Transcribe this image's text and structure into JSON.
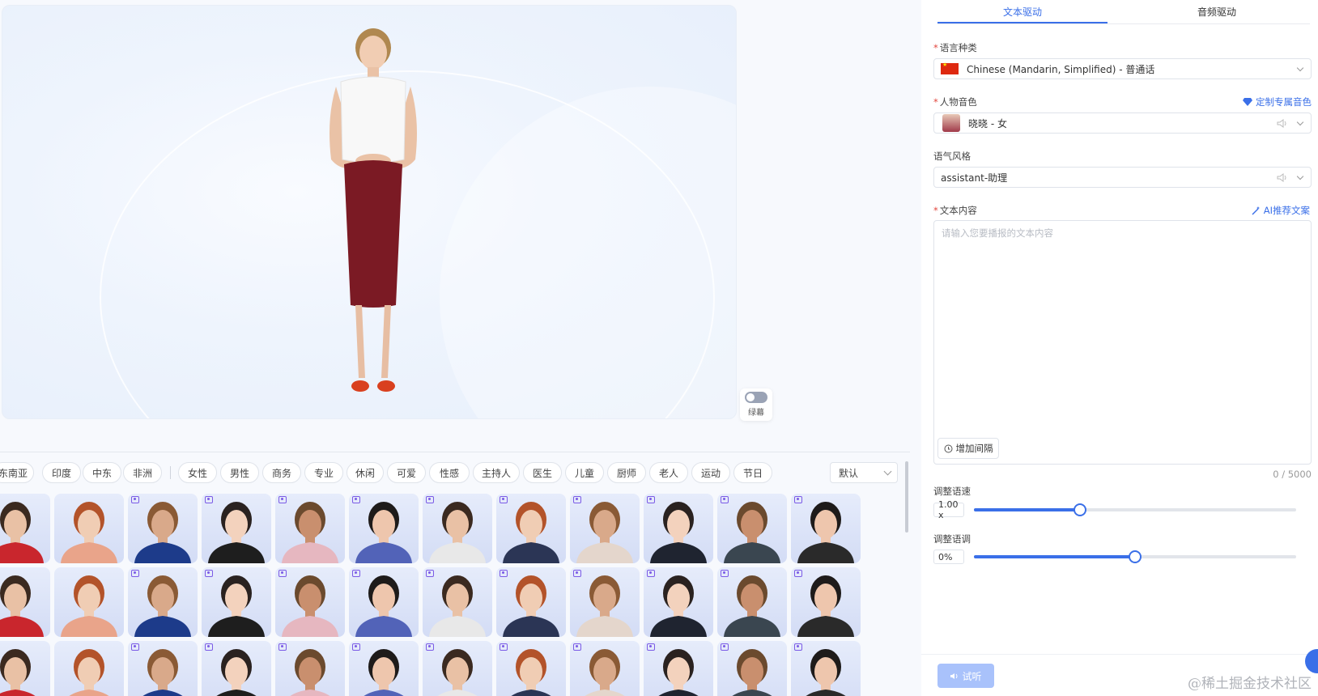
{
  "preview": {
    "green_screen_label": "绿幕"
  },
  "filters": {
    "region_chips": [
      "东南亚",
      "印度",
      "中东",
      "非洲"
    ],
    "tag_chips": [
      "女性",
      "男性",
      "商务",
      "专业",
      "休闲",
      "可爱",
      "性感",
      "主持人",
      "医生",
      "儿童",
      "厨师",
      "老人",
      "运动",
      "节日"
    ],
    "sort_value": "默认"
  },
  "panel": {
    "tabs": [
      "文本驱动",
      "音频驱动"
    ],
    "language": {
      "label": "语言种类",
      "value": "Chinese (Mandarin, Simplified) - 普通话"
    },
    "voice": {
      "label": "人物音色",
      "value": "晓晓 - 女",
      "custom_link": "定制专属音色"
    },
    "style": {
      "label": "语气风格",
      "value": "assistant-助理"
    },
    "text": {
      "label": "文本内容",
      "ai_link": "AI推荐文案",
      "placeholder": "请输入您要播报的文本内容",
      "add_pause": "增加间隔",
      "count": "0 / 5000"
    },
    "speed": {
      "label": "调整语速",
      "value": "1.00 x",
      "level": 0.33
    },
    "pitch": {
      "label": "调整语调",
      "value": "0%",
      "level": 0.5
    },
    "try_button": "试听",
    "watermark": "@稀土掘金技术社区"
  },
  "colors": {
    "accent": "#3a6fe8",
    "required": "#e2463d"
  }
}
